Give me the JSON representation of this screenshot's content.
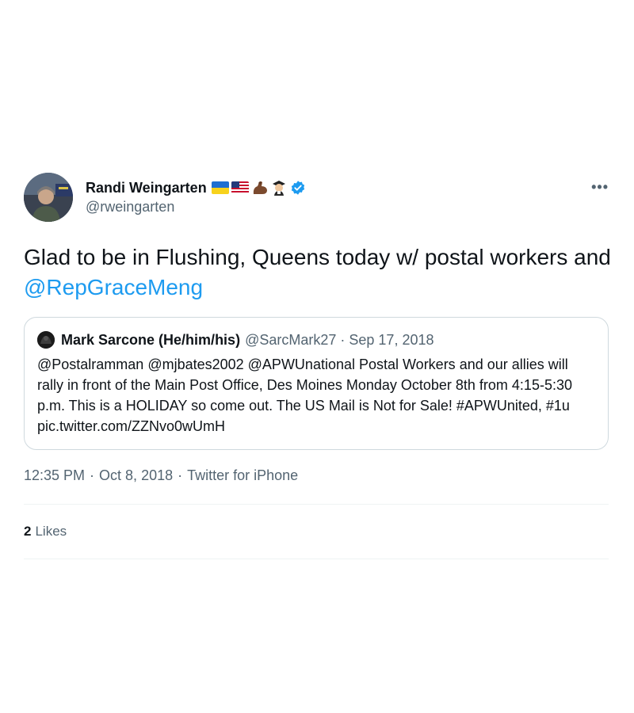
{
  "author": {
    "display_name": "Randi Weingarten",
    "handle": "@rweingarten",
    "emojis": [
      "ukraine-flag",
      "us-flag",
      "flexed-biceps",
      "teacher"
    ],
    "verified": true
  },
  "more_label": "•••",
  "tweet": {
    "text_before": "Glad to be in Flushing, Queens today w/ postal workers and ",
    "mention": "@RepGraceMeng"
  },
  "quote": {
    "display_name": "Mark Sarcone (He/him/his)",
    "handle": "@SarcMark27",
    "separator": "·",
    "date": "Sep 17, 2018",
    "text": "@Postalramman @mjbates2002 @APWUnational Postal Workers and our allies will rally in front of the Main Post Office, Des Moines Monday October 8th from 4:15-5:30 p.m. This is a HOLIDAY so come out.  The US Mail is Not for Sale! #APWUnited, #1u pic.twitter.com/ZZNvo0wUmH"
  },
  "meta": {
    "time": "12:35 PM",
    "date": "Oct 8, 2018",
    "source": "Twitter for iPhone",
    "separator": "·"
  },
  "stats": {
    "likes_count": "2",
    "likes_label": "Likes"
  },
  "colors": {
    "mention": "#1d9bf0",
    "secondary_text": "#536471",
    "border": "#cfd9de"
  }
}
